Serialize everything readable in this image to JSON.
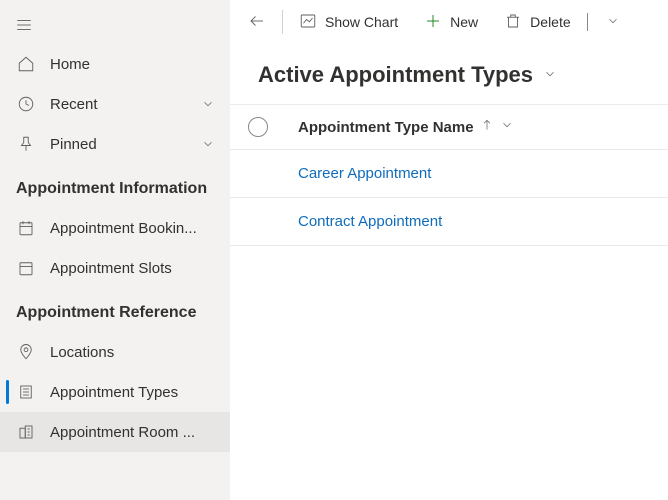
{
  "sidebar": {
    "primary": [
      {
        "label": "Home"
      },
      {
        "label": "Recent"
      },
      {
        "label": "Pinned"
      }
    ],
    "sections": [
      {
        "title": "Appointment Information",
        "items": [
          {
            "label": "Appointment Bookin..."
          },
          {
            "label": "Appointment Slots"
          }
        ]
      },
      {
        "title": "Appointment Reference",
        "items": [
          {
            "label": "Locations"
          },
          {
            "label": "Appointment Types"
          },
          {
            "label": "Appointment Room ..."
          }
        ]
      }
    ]
  },
  "commands": {
    "show_chart": "Show Chart",
    "new": "New",
    "delete": "Delete"
  },
  "view": {
    "title": "Active Appointment Types",
    "column": "Appointment Type Name",
    "rows": [
      "Career Appointment",
      "Contract Appointment"
    ]
  }
}
